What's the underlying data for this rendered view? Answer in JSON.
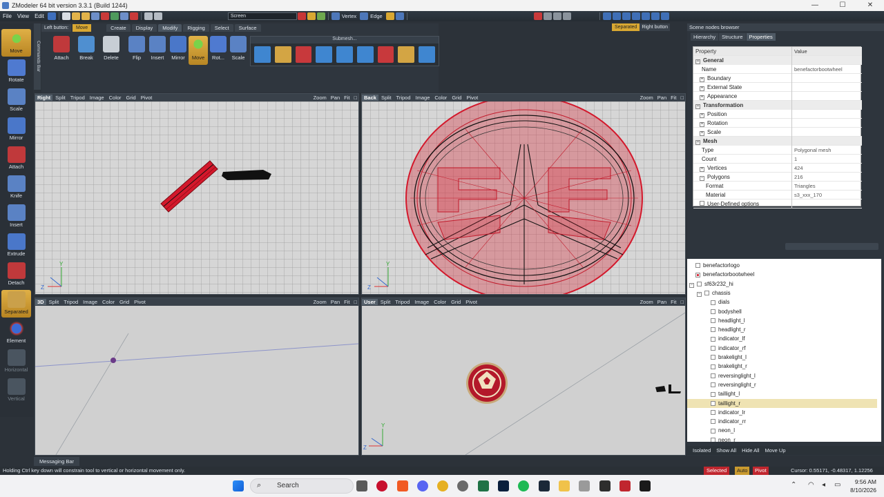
{
  "window": {
    "title": "ZModeler 64 bit version 3.3.1 (Build 1244)",
    "controls": [
      "—",
      "☐",
      "✕"
    ]
  },
  "menu": [
    "File",
    "View",
    "Edit"
  ],
  "top_toolbar": {
    "screen_select": "Screen",
    "vertex_label": "Vertex",
    "edge_label": "Edge"
  },
  "left_tools": [
    {
      "label": "Move",
      "active": true
    },
    {
      "label": "Rotate"
    },
    {
      "label": "Scale"
    },
    {
      "label": "Mirror"
    },
    {
      "label": "Attach"
    },
    {
      "label": "Knife"
    },
    {
      "label": "Insert"
    },
    {
      "label": "Extrude"
    },
    {
      "label": "Detach"
    },
    {
      "label": "Separated",
      "active": true
    },
    {
      "label": "Element"
    },
    {
      "label": "Horizontal",
      "dim": true
    },
    {
      "label": "Vertical",
      "dim": true
    }
  ],
  "commands_bar_label": "Commands Bar",
  "ribbon": {
    "left_button_label": "Left button:",
    "left_button_value": "Move",
    "tabs": [
      "Create",
      "Display",
      "Modify",
      "Rigging",
      "Select",
      "Surface"
    ],
    "active_tab": "Modify",
    "buttons": [
      "Attach",
      "Break",
      "Delete",
      "Flip",
      "Insert",
      "Mirror",
      "Move",
      "Rot...",
      "Scale"
    ],
    "submesh_label": "Submesh...",
    "separated_label": "Separated",
    "right_button_label": "Right button"
  },
  "viewport_menu": [
    "Split",
    "Tripod",
    "Image",
    "Color",
    "Grid",
    "Pivot"
  ],
  "viewport_tools": [
    "Zoom",
    "Pan",
    "Fit"
  ],
  "viewports": {
    "top_left": "Right",
    "top_right": "Back",
    "bottom_left": "3D",
    "bottom_right": "User"
  },
  "axis": {
    "x": "X",
    "y": "Y",
    "z": "Z"
  },
  "scene_nodes": {
    "title": "Scene nodes browser",
    "tabs": [
      "Hierarchy",
      "Structure",
      "Properties"
    ],
    "active_tab": "Properties",
    "columns": {
      "property": "Property",
      "value": "Value"
    },
    "properties": [
      {
        "name": "General",
        "value": "",
        "kind": "cat",
        "indent": 0,
        "exp": "−"
      },
      {
        "name": "Name",
        "value": "benefactorbootwheel",
        "indent": 2
      },
      {
        "name": "Boundary",
        "value": "",
        "indent": 1,
        "exp": "+"
      },
      {
        "name": "External State",
        "value": "",
        "indent": 1,
        "exp": "+"
      },
      {
        "name": "Appearance",
        "value": "",
        "indent": 1,
        "exp": "+"
      },
      {
        "name": "Transformation",
        "value": "",
        "kind": "cat",
        "indent": 0,
        "exp": "−"
      },
      {
        "name": "Position",
        "value": "",
        "indent": 1,
        "exp": "+"
      },
      {
        "name": "Rotation",
        "value": "",
        "indent": 1,
        "exp": "+"
      },
      {
        "name": "Scale",
        "value": "",
        "indent": 1,
        "exp": "+"
      },
      {
        "name": "Mesh",
        "value": "",
        "kind": "cat",
        "indent": 0,
        "exp": "−"
      },
      {
        "name": "Type",
        "value": "Polygonal mesh",
        "indent": 2
      },
      {
        "name": "Count",
        "value": "1",
        "indent": 2
      },
      {
        "name": "Vertices",
        "value": "424",
        "indent": 1,
        "exp": "+"
      },
      {
        "name": "Polygons",
        "value": "216",
        "indent": 1,
        "exp": "−"
      },
      {
        "name": "Format",
        "value": "Triangles",
        "indent": 3
      },
      {
        "name": "Material",
        "value": "s3_xxx_170",
        "indent": 3
      },
      {
        "name": "User-Defined options",
        "value": "",
        "indent": 1,
        "check": true
      }
    ],
    "tree": [
      {
        "label": "benefactorlogo",
        "indent": 0
      },
      {
        "label": "benefactorbootwheel",
        "indent": 0,
        "red": true
      },
      {
        "label": "sf63r232_hi",
        "indent": 0,
        "exp": true
      },
      {
        "label": "chassis",
        "indent": 1,
        "exp": true
      },
      {
        "label": "dials",
        "indent": 2
      },
      {
        "label": "bodyshell",
        "indent": 2
      },
      {
        "label": "headlight_l",
        "indent": 2
      },
      {
        "label": "headlight_r",
        "indent": 2
      },
      {
        "label": "indicator_lf",
        "indent": 2
      },
      {
        "label": "indicator_rf",
        "indent": 2
      },
      {
        "label": "brakelight_l",
        "indent": 2
      },
      {
        "label": "brakelight_r",
        "indent": 2
      },
      {
        "label": "reversinglight_l",
        "indent": 2
      },
      {
        "label": "reversinglight_r",
        "indent": 2
      },
      {
        "label": "taillight_l",
        "indent": 2
      },
      {
        "label": "taillight_r",
        "indent": 2,
        "sel": true
      },
      {
        "label": "indicator_lr",
        "indent": 2
      },
      {
        "label": "indicator_rr",
        "indent": 2
      },
      {
        "label": "neon_l",
        "indent": 2
      },
      {
        "label": "neon_r",
        "indent": 2
      }
    ],
    "bottom": [
      "Isolated",
      "Show All",
      "Hide All",
      "Move Up"
    ]
  },
  "messaging_bar": "Messaging Bar",
  "status": {
    "hint": "Holding Ctrl key down will constrain tool to vertical or horizontal movement only.",
    "selected": "Selected",
    "auto": "Auto",
    "pivot": "Pivot",
    "cursor": "Cursor: 0.55171, -0.48317, 1.12256"
  },
  "taskbar": {
    "search": "Search",
    "time": "9:56 AM",
    "date": "8/10/2026"
  },
  "colors": {
    "accent": "#d9a832",
    "mesh_red": "#d3182b",
    "wire_black": "#111111"
  }
}
